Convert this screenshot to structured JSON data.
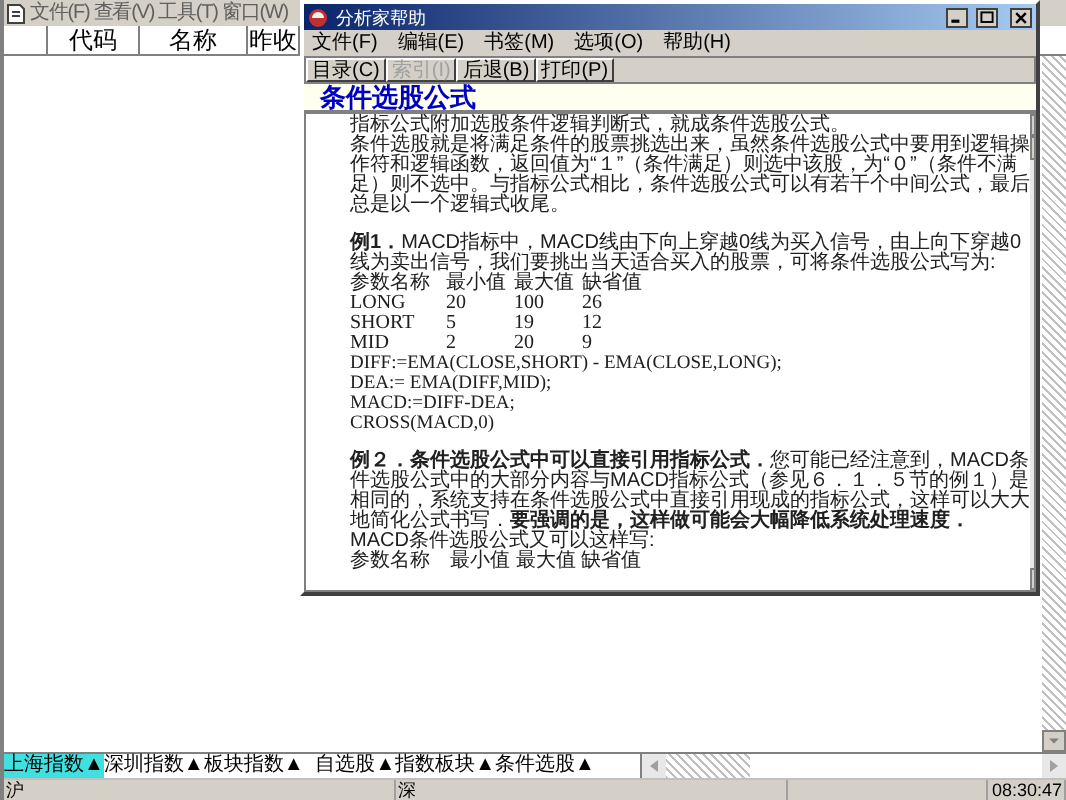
{
  "app": {
    "menu": [
      "文件(F)",
      "查看(V)",
      "工具(T)",
      "窗口(W)"
    ],
    "table": {
      "columns": [
        "",
        "代码",
        "名称",
        "昨收"
      ]
    },
    "sheet_tabs": [
      {
        "label": "上海指数▲",
        "selected": true
      },
      {
        "label": "深圳指数▲",
        "selected": false
      },
      {
        "label": "板块指数▲",
        "selected": false
      },
      {
        "label": "自选股▲",
        "selected": false
      },
      {
        "label": "指数板块▲",
        "selected": false
      },
      {
        "label": "条件选股▲",
        "selected": false
      }
    ],
    "status_bar": [
      "沪",
      "深",
      "08:30:47"
    ]
  },
  "help_window": {
    "title": "分析家帮助",
    "menu": [
      "文件(F)",
      "编辑(E)",
      "书签(M)",
      "选项(O)",
      "帮助(H)"
    ],
    "toolbar": [
      {
        "label": "目录(C)",
        "disabled": false
      },
      {
        "label": "索引(I)",
        "disabled": true
      },
      {
        "label": "后退(B)",
        "disabled": false
      },
      {
        "label": "打印(P)",
        "disabled": false
      }
    ],
    "heading": "条件选股公式",
    "content": [
      {
        "kind": "paragraph",
        "text": "指标公式附加选股条件逻辑判断式，就成条件选股公式。"
      },
      {
        "kind": "paragraph",
        "text": "条件选股就是将满足条件的股票挑选出来，虽然条件选股公式中要用到逻辑操作符和逻辑函数，返回值为“１”（条件满足）则选中该股，为“０”（条件不满足）则不选中。与指标公式相比，条件选股公式可以有若干个中间公式，最后总是以一个逻辑式收尾。"
      },
      {
        "kind": "gap"
      },
      {
        "kind": "paragraph",
        "text": "**例1．**MACD指标中，MACD线由下向上穿越0线为买入信号，由上向下穿越0线为卖出信号，我们要挑出当天适合买入的股票，可将条件选股公式写为:"
      },
      {
        "kind": "table",
        "rows": [
          [
            "参数名称",
            "最小值",
            "最大值",
            "缺省值"
          ],
          [
            "LONG",
            "20",
            "100",
            "26"
          ],
          [
            "SHORT",
            "5",
            "19",
            "12"
          ],
          [
            "MID",
            "2",
            "20",
            "9"
          ]
        ]
      },
      {
        "kind": "code",
        "text": "DIFF:=EMA(CLOSE,SHORT) - EMA(CLOSE,LONG);"
      },
      {
        "kind": "code",
        "text": "DEA:= EMA(DIFF,MID);"
      },
      {
        "kind": "code",
        "text": "MACD:=DIFF-DEA;"
      },
      {
        "kind": "code",
        "text": "CROSS(MACD,0)"
      },
      {
        "kind": "gap"
      },
      {
        "kind": "paragraph",
        "text": "**例２．条件选股公式中可以直接引用指标公式．**您可能已经注意到，MACD条件选股公式中的大部分内容与MACD指标公式（参见６．１．５节的例１）是相同的，系统支持在条件选股公式中直接引用现成的指标公式，这样可以大大地简化公式书写．**要强调的是，这样做可能会大幅降低系统处理速度．**"
      },
      {
        "kind": "paragraph",
        "text": "MACD条件选股公式又可以这样写:"
      },
      {
        "kind": "paragraph",
        "text": "参数名称　最小值 最大值 缺省值"
      }
    ]
  }
}
